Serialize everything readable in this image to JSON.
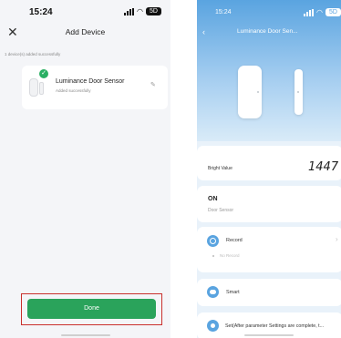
{
  "left": {
    "status": {
      "time": "15:24",
      "battery": "5D"
    },
    "header": {
      "close_glyph": "✕",
      "title": "Add Device"
    },
    "added_count": "1 device(s) added successfully",
    "device": {
      "name": "Luminance Door Sensor",
      "status": "Added successfully",
      "badge_icon": "check-icon",
      "edit_icon": "pencil-icon"
    },
    "done_label": "Done",
    "colors": {
      "accent": "#2aa35b",
      "highlight": "#c9302c"
    }
  },
  "right": {
    "status": {
      "time": "15:24",
      "battery": "5D"
    },
    "header": {
      "back_glyph": "‹",
      "title": "Luminance Door Sen..."
    },
    "bright": {
      "label": "Bright Value",
      "value": "1447"
    },
    "door": {
      "status": "ON",
      "label": "Door Sensor"
    },
    "record": {
      "label": "Record",
      "empty_text": "No Record",
      "chevron": "›"
    },
    "smart": {
      "label": "Smart"
    },
    "settings": {
      "label": "Set(After parameter Settings are complete, t..."
    },
    "colors": {
      "accent": "#5aa4e0"
    }
  }
}
